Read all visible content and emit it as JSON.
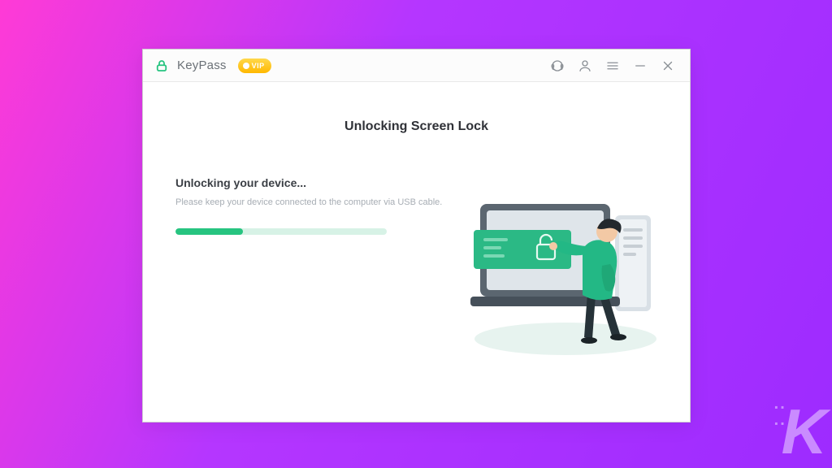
{
  "titlebar": {
    "app_name": "KeyPass",
    "vip_label": "VIP"
  },
  "main": {
    "title": "Unlocking Screen Lock",
    "status": "Unlocking your device...",
    "instruction": "Please keep your device connected to the computer via USB cable.",
    "progress_percent": 32
  },
  "colors": {
    "accent": "#27c480"
  },
  "watermark": "K"
}
